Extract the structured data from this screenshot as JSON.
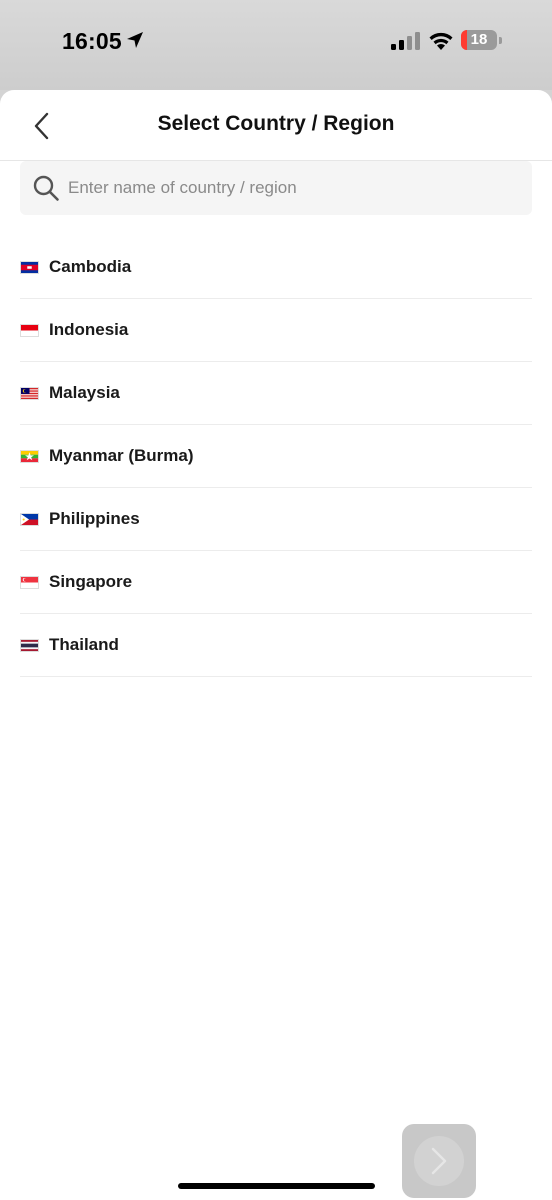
{
  "status_bar": {
    "time": "16:05",
    "battery_level": "18",
    "battery_fraction": 0.18,
    "icons": [
      "location-arrow-icon",
      "cellular-signal-icon",
      "wifi-icon",
      "battery-icon"
    ]
  },
  "header": {
    "title": "Select Country / Region",
    "back_icon": "chevron-left-icon"
  },
  "search": {
    "placeholder": "Enter name of country / region",
    "value": "",
    "icon": "search-icon"
  },
  "countries": [
    {
      "name": "Cambodia",
      "flag": "cambodia-flag-icon"
    },
    {
      "name": "Indonesia",
      "flag": "indonesia-flag-icon"
    },
    {
      "name": "Malaysia",
      "flag": "malaysia-flag-icon"
    },
    {
      "name": "Myanmar (Burma)",
      "flag": "myanmar-flag-icon"
    },
    {
      "name": "Philippines",
      "flag": "philippines-flag-icon"
    },
    {
      "name": "Singapore",
      "flag": "singapore-flag-icon"
    },
    {
      "name": "Thailand",
      "flag": "thailand-flag-icon"
    }
  ],
  "floating_button": {
    "icon": "chevron-right-icon"
  },
  "colors": {
    "accent_battery": "#ff3b30",
    "text_primary": "#111111",
    "placeholder": "#8a8a8a",
    "divider": "#ececec"
  }
}
